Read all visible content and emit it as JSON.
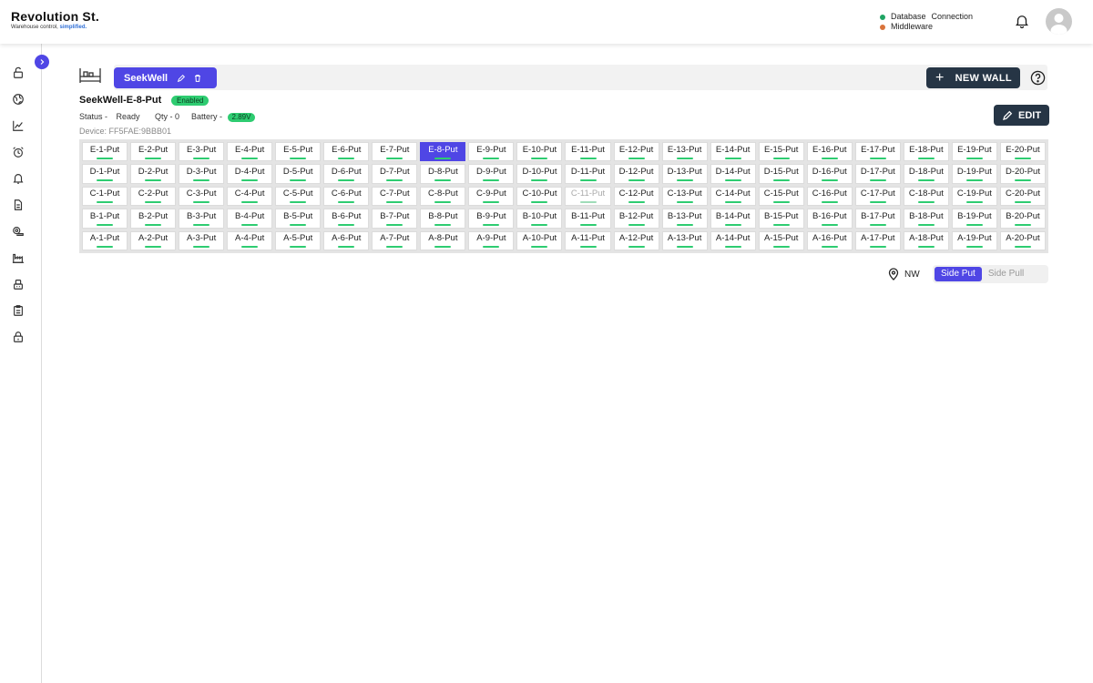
{
  "brand": {
    "name": "Revolution St.",
    "tagline_prefix": "Warehouse control, ",
    "tagline_highlight": "simplified."
  },
  "status": {
    "database_label": "Database",
    "connection_label": "Connection",
    "middleware_label": "Middleware",
    "database_color": "#1fa463",
    "middleware_color": "#d9733b"
  },
  "header_icons": [
    "bell-icon",
    "user-avatar"
  ],
  "sidebar": {
    "icons": [
      "lock-open-icon",
      "globe-icon",
      "chart-line-icon",
      "alarm-clock-icon",
      "bell-icon",
      "document-icon",
      "tape-icon",
      "factory-icon",
      "robot-icon",
      "clipboard-icon",
      "lock-icon"
    ]
  },
  "wall": {
    "name": "SeekWell",
    "new_wall_label": "NEW WALL"
  },
  "device": {
    "title": "SeekWell-E-8-Put",
    "badge": "Enabled",
    "status_label": "Status -",
    "status_value": "Ready",
    "qty_label": "Qty -",
    "qty_value": "0",
    "battery_label": "Battery -",
    "battery_value": "2.89V",
    "device_id": "Device: FF5FAE:9BBB01",
    "edit_label": "EDIT"
  },
  "grid": {
    "rows": [
      "E",
      "D",
      "C",
      "B",
      "A"
    ],
    "cols": 20,
    "suffix": "-Put",
    "selected": "E-8-Put",
    "disabled": [
      "C-11-Put"
    ]
  },
  "controls": {
    "location": "NW",
    "side_put_label": "Side Put",
    "side_pull_label": "Side Pull",
    "active": "Side Put"
  },
  "colors": {
    "accent": "#4f46e5",
    "dark_button": "#263545",
    "green": "#2ecc71"
  }
}
